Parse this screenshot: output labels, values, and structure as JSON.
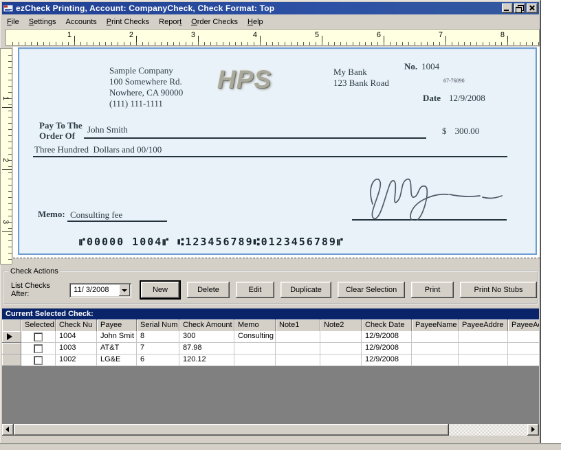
{
  "window": {
    "title": "ezCheck Printing, Account: CompanyCheck, Check Format: Top"
  },
  "menu": {
    "items": [
      {
        "pre": "",
        "key": "F",
        "post": "ile"
      },
      {
        "pre": "",
        "key": "S",
        "post": "ettings"
      },
      {
        "pre": "Accounts",
        "key": "",
        "post": ""
      },
      {
        "pre": "",
        "key": "P",
        "post": "rint Checks"
      },
      {
        "pre": "Repor",
        "key": "t",
        "post": ""
      },
      {
        "pre": "",
        "key": "O",
        "post": "rder Checks"
      },
      {
        "pre": "",
        "key": "H",
        "post": "elp"
      }
    ]
  },
  "ruler": {
    "h_numbers": [
      "1",
      "2",
      "3",
      "4",
      "5",
      "6",
      "7",
      "8"
    ],
    "v_numbers": [
      "1",
      "2",
      "3"
    ]
  },
  "check": {
    "company": {
      "name": "Sample Company",
      "address1": "100 Somewhere Rd.",
      "address2": "Nowhere, CA 90000",
      "phone": "(111) 111-1111"
    },
    "logo_text": "HPS",
    "bank": {
      "name": "My Bank",
      "address": "123 Bank Road"
    },
    "number_label": "No.",
    "number": "1004",
    "fraction": "67-76890",
    "date_label": "Date",
    "date": "12/9/2008",
    "pay_to_line1": "Pay To The",
    "pay_to_line2": "Order Of",
    "payee": "John Smith",
    "dollar_sign": "$",
    "amount": "300.00",
    "amount_words": "Three Hundred  Dollars and 00/100",
    "memo_label": "Memo:",
    "memo": "Consulting fee",
    "micr": "⑈00000 1004⑈ ⑆123456789⑆0123456789⑈"
  },
  "actions": {
    "group_label": "Check Actions",
    "list_after_label": "List Checks After:",
    "date_value": "11/ 3/2008",
    "buttons": [
      "New",
      "Delete",
      "Edit",
      "Duplicate",
      "Clear Selection",
      "Print",
      "Print No Stubs"
    ]
  },
  "selected_header": "Current Selected Check:",
  "grid": {
    "columns": [
      "",
      "Selected",
      "Check Nu",
      "Payee",
      "Serial Num",
      "Check Amount",
      "Memo",
      "Note1",
      "Note2",
      "Check Date",
      "PayeeName",
      "PayeeAddre",
      "PayeeAc"
    ],
    "rows": [
      {
        "check_no": "1004",
        "payee": "John Smit",
        "serial": "8",
        "amount": "300",
        "memo": "Consulting",
        "note1": "",
        "note2": "",
        "date": "12/9/2008",
        "payee_name": "",
        "payee_addr": "",
        "payee_ac": ""
      },
      {
        "check_no": "1003",
        "payee": "AT&T",
        "serial": "7",
        "amount": "87.98",
        "memo": "",
        "note1": "",
        "note2": "",
        "date": "12/9/2008",
        "payee_name": "",
        "payee_addr": "",
        "payee_ac": ""
      },
      {
        "check_no": "1002",
        "payee": "LG&E",
        "serial": "6",
        "amount": "120.12",
        "memo": "",
        "note1": "",
        "note2": "",
        "date": "12/9/2008",
        "payee_name": "",
        "payee_addr": "",
        "payee_ac": ""
      }
    ]
  },
  "colors": {
    "titlebar_blue": "#2d51a4",
    "header_bar_navy": "#0a246a",
    "check_background": "#e9f2f9",
    "check_border": "#6f9cd1",
    "chrome_gray": "#d4d0c8",
    "ruler_cream": "#ffffe1",
    "empty_grid_gray": "#808080"
  }
}
